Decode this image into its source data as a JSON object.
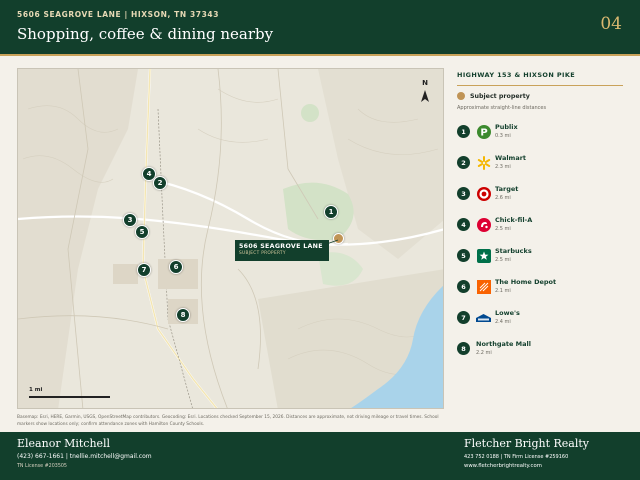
{
  "header": {
    "address_line": "5606 SEAGROVE LANE  |  HIXSON, TN 37343",
    "title": "Shopping, coffee & dining nearby",
    "page_number": "04"
  },
  "colors": {
    "forest_green": "#123f2c",
    "gold": "#c9a25a",
    "subject_marker": "#c09456",
    "water": "#a9d3ea",
    "background": "#f4f1ea"
  },
  "map": {
    "north_label": "N",
    "subject_label": {
      "title": "5606 SEAGROVE LANE",
      "subtitle": "SUBJECT PROPERTY"
    },
    "scale_label": "1 mi",
    "markers": [
      "1",
      "2",
      "3",
      "4",
      "5",
      "6",
      "7",
      "8"
    ],
    "basemap_note": "Basemap: Esri, HERE, Garmin, USGS, OpenStreetMap contributors. Geocoding: Esri. Locations checked September 15, 2026. Distances are approximate, not driving mileage or travel times. School markers show locations only; confirm attendance zones with Hamilton County Schools."
  },
  "panel": {
    "heading": "HIGHWAY 153 & HIXSON PIKE",
    "legend_label": "Subject property",
    "legend_note": "Approximate straight-line distances",
    "places": [
      {
        "num": "1",
        "name": "Publix",
        "dist": "0.3 mi",
        "icon": "publix-logo-icon"
      },
      {
        "num": "2",
        "name": "Walmart",
        "dist": "2.3 mi",
        "icon": "walmart-spark-icon"
      },
      {
        "num": "3",
        "name": "Target",
        "dist": "2.6 mi",
        "icon": "target-bullseye-icon"
      },
      {
        "num": "4",
        "name": "Chick-fil-A",
        "dist": "2.5 mi",
        "icon": "chick-fil-a-logo-icon"
      },
      {
        "num": "5",
        "name": "Starbucks",
        "dist": "2.5 mi",
        "icon": "starbucks-logo-icon"
      },
      {
        "num": "6",
        "name": "The Home Depot",
        "dist": "2.1 mi",
        "icon": "home-depot-logo-icon"
      },
      {
        "num": "7",
        "name": "Lowe's",
        "dist": "2.4 mi",
        "icon": "lowes-logo-icon"
      },
      {
        "num": "8",
        "name": "Northgate Mall",
        "dist": "2.2 mi",
        "icon": ""
      }
    ]
  },
  "footer": {
    "agent_name": "Eleanor Mitchell",
    "agent_contact": "(423) 667-1661  |  tnellie.mitchell@gmail.com",
    "agent_license": "TN License #203505",
    "brokerage_name": "Fletcher Bright Realty",
    "brokerage_line": "423 752 0188  |  TN Firm License #259160",
    "brokerage_web": "www.fletcherbrightrealty.com"
  }
}
